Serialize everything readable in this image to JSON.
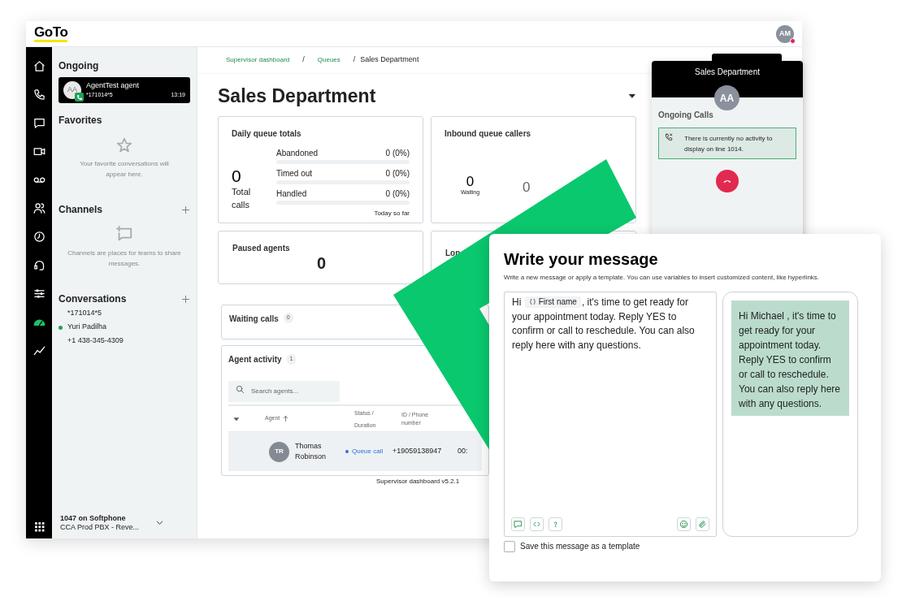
{
  "logo": "GoTo",
  "user_avatar": {
    "initials": "AM"
  },
  "rail": [
    {
      "kind": "home",
      "selected": false
    },
    {
      "kind": "phone",
      "selected": false
    },
    {
      "kind": "chat",
      "selected": false
    },
    {
      "kind": "video",
      "selected": false
    },
    {
      "kind": "voicemail",
      "selected": false
    },
    {
      "kind": "people",
      "selected": false
    },
    {
      "kind": "history",
      "selected": false
    },
    {
      "kind": "headset",
      "selected": false
    },
    {
      "kind": "sliders",
      "selected": false
    },
    {
      "kind": "gauge",
      "selected": true
    },
    {
      "kind": "analytics",
      "selected": false
    }
  ],
  "sidebar": {
    "ongoing": {
      "heading": "Ongoing",
      "call": {
        "initials": "AA",
        "name": "AgentTest agent",
        "number": "*171014*5",
        "time": "13:19"
      }
    },
    "favorites": {
      "heading": "Favorites",
      "empty_text": "Your favorite conversations will appear here."
    },
    "channels": {
      "heading": "Channels",
      "empty_text": "Channels are places for teams to share messages."
    },
    "conversations": {
      "heading": "Conversations",
      "items": [
        {
          "label": "*171014*5",
          "online": false
        },
        {
          "label": "Yuri Padilha",
          "online": true
        },
        {
          "label": "+1 438-345-4309",
          "online": false
        }
      ]
    },
    "footer": {
      "line": "1047 on Softphone",
      "detail": "CCA Prod PBX - Reve..."
    }
  },
  "breadcrumb": [
    {
      "label": "Supervisor dashboard",
      "kind": "link"
    },
    {
      "separator": "/",
      "label": "Queues",
      "kind": "link"
    },
    {
      "separator": "/",
      "label": "Sales Department",
      "kind": "current"
    }
  ],
  "page_title": "Sales Department",
  "daily_totals": {
    "title": "Daily queue totals",
    "total": "0",
    "total_label": "Total calls",
    "rows": [
      {
        "label": "Abandoned",
        "value": "0 (0%)",
        "level": 0
      },
      {
        "label": "Timed out",
        "value": "0 (0%)",
        "level": 0
      },
      {
        "label": "Handled",
        "value": "0 (0%)",
        "level": 0
      }
    ],
    "footnote": "Today so far"
  },
  "inbound": {
    "title": "Inbound queue callers",
    "waiting": "0",
    "waiting_label": "Waiting",
    "second": "0"
  },
  "paused": {
    "title": "Paused agents",
    "value": "0"
  },
  "longest": {
    "title": "Lon"
  },
  "waiting_calls": {
    "title": "Waiting calls",
    "count": "0"
  },
  "agent_activity": {
    "title": "Agent activity",
    "count": "1",
    "search": {
      "placeholder": "Search agents..."
    },
    "columns": [
      "Agent",
      "Status / Duration",
      "ID / Phone number"
    ],
    "rows": [
      {
        "initials": "TR",
        "name": "Thomas Robinson",
        "status": "Queue call",
        "phone": "+19059138947",
        "column_4": "00:"
      }
    ]
  },
  "version": "Supervisor dashboard v5.2.1",
  "call_panel": {
    "title": "Sales Department",
    "initials": "AA",
    "heading": "Ongoing Calls",
    "notice": "There is currently no activity to display on line 1014."
  },
  "message_dialog": {
    "title": "Write your message",
    "description": "Write a new message or apply a template. You can use variables to insert customized content, like hyperlinks.",
    "editor": {
      "before": "Hi",
      "variable": "First name",
      "after": ", it's time to get ready for your appointment today. Reply YES to confirm or call to reschedule. You can also reply here with any questions."
    },
    "toolbar_left": [
      {
        "kind": "chat"
      },
      {
        "kind": "code"
      },
      {
        "kind": "help"
      }
    ],
    "toolbar_right": [
      {
        "kind": "emoji"
      },
      {
        "kind": "attach"
      }
    ],
    "preview": "Hi Michael , it's time to get ready for your appointment today. Reply YES to confirm or call to reschedule. You can also reply here with any questions.",
    "save_template": {
      "label": "Save this message as a template",
      "checked": false
    }
  }
}
